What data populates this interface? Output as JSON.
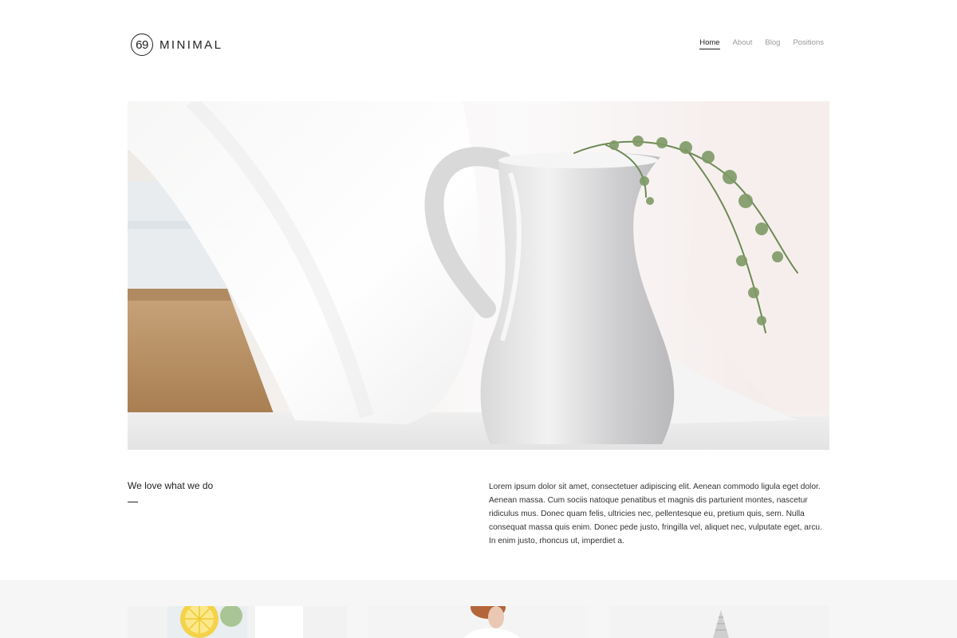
{
  "logo": {
    "mark": "69",
    "wordmark": "MINIMAL"
  },
  "nav": {
    "items": [
      {
        "label": "Home",
        "active": true
      },
      {
        "label": "About",
        "active": false
      },
      {
        "label": "Blog",
        "active": false
      },
      {
        "label": "Positions",
        "active": false
      }
    ]
  },
  "intro": {
    "title": "We love what we do",
    "body": "Lorem ipsum dolor sit amet, consectetuer adipiscing elit. Aenean commodo ligula eget dolor. Aenean massa. Cum sociis natoque penatibus et magnis dis parturient montes, nascetur ridiculus mus. Donec quam felis, ultricies nec, pellentesque eu, pretium quis, sem. Nulla consequat massa quis enim. Donec pede justo, fringilla vel, aliquet nec, vulputate eget, arcu. In enim justo, rhoncus ut, imperdiet a."
  },
  "colors": {
    "text": "#222222",
    "muted": "#9a9a9a",
    "gallery_bg": "#f6f6f6"
  },
  "images": {
    "hero": "white-pitcher-with-greenery",
    "gallery": [
      "lemon-water-glass",
      "woman-portrait",
      "white-object"
    ]
  }
}
